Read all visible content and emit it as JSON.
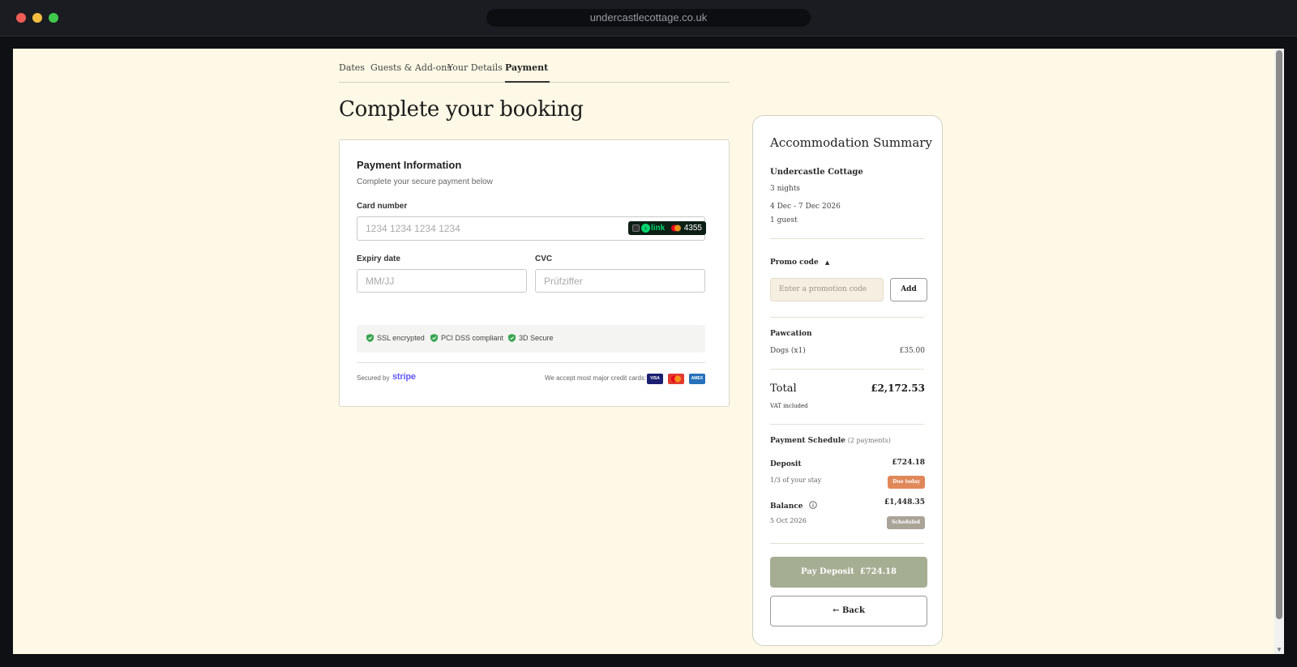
{
  "browser": {
    "url": "undercastlecottage.co.uk"
  },
  "steps": [
    {
      "label": "Dates"
    },
    {
      "label": "Guests & Add-ons"
    },
    {
      "label": "Your Details"
    },
    {
      "label": "Payment",
      "active": true
    }
  ],
  "page_title": "Complete your booking",
  "payment": {
    "title": "Payment Information",
    "subtitle": "Complete your secure payment below",
    "card_number_label": "Card number",
    "card_number_placeholder": "1234 1234 1234 1234",
    "link_badge": {
      "word": "link",
      "last4": "4355"
    },
    "expiry_label": "Expiry date",
    "expiry_placeholder": "MM/JJ",
    "cvc_label": "CVC",
    "cvc_placeholder": "Prüfziffer",
    "security": [
      "SSL encrypted",
      "PCI DSS compliant",
      "3D Secure"
    ],
    "secured_by": "Secured by",
    "stripe": "stripe",
    "accept_text": "We accept most major credit cards:",
    "cards": {
      "visa": "VISA",
      "amex": "AMEX"
    }
  },
  "summary": {
    "title": "Accommodation Summary",
    "property": "Undercastle Cottage",
    "nights": "3 nights",
    "dates": "4 Dec - 7 Dec 2026",
    "guests": "1 guest",
    "promo_label": "Promo code",
    "promo_placeholder": "Enter a promotion code",
    "promo_add": "Add",
    "addon_title": "Pawcation",
    "addon_item": "Dogs (x1)",
    "addon_price": "£35.00",
    "total_label": "Total",
    "total_value": "£2,172.53",
    "vat": "VAT included",
    "schedule_label": "Payment Schedule",
    "schedule_count": "(2 payments)",
    "deposit_label": "Deposit",
    "deposit_amount": "£724.18",
    "deposit_note": "1/3 of your stay",
    "deposit_badge": "Due today",
    "balance_label": "Balance",
    "balance_amount": "£1,448.35",
    "balance_date": "5 Oct 2026",
    "balance_badge": "Scheduled",
    "pay_button": "Pay Deposit  £724.18",
    "back_button": "← Back"
  },
  "colors": {
    "page_bg": "#fdf9e6",
    "pay_button": "#a5ad93",
    "due_badge": "#e0885a",
    "scheduled_badge": "#aaa398",
    "stripe": "#635bff",
    "shield": "#3aa551"
  }
}
